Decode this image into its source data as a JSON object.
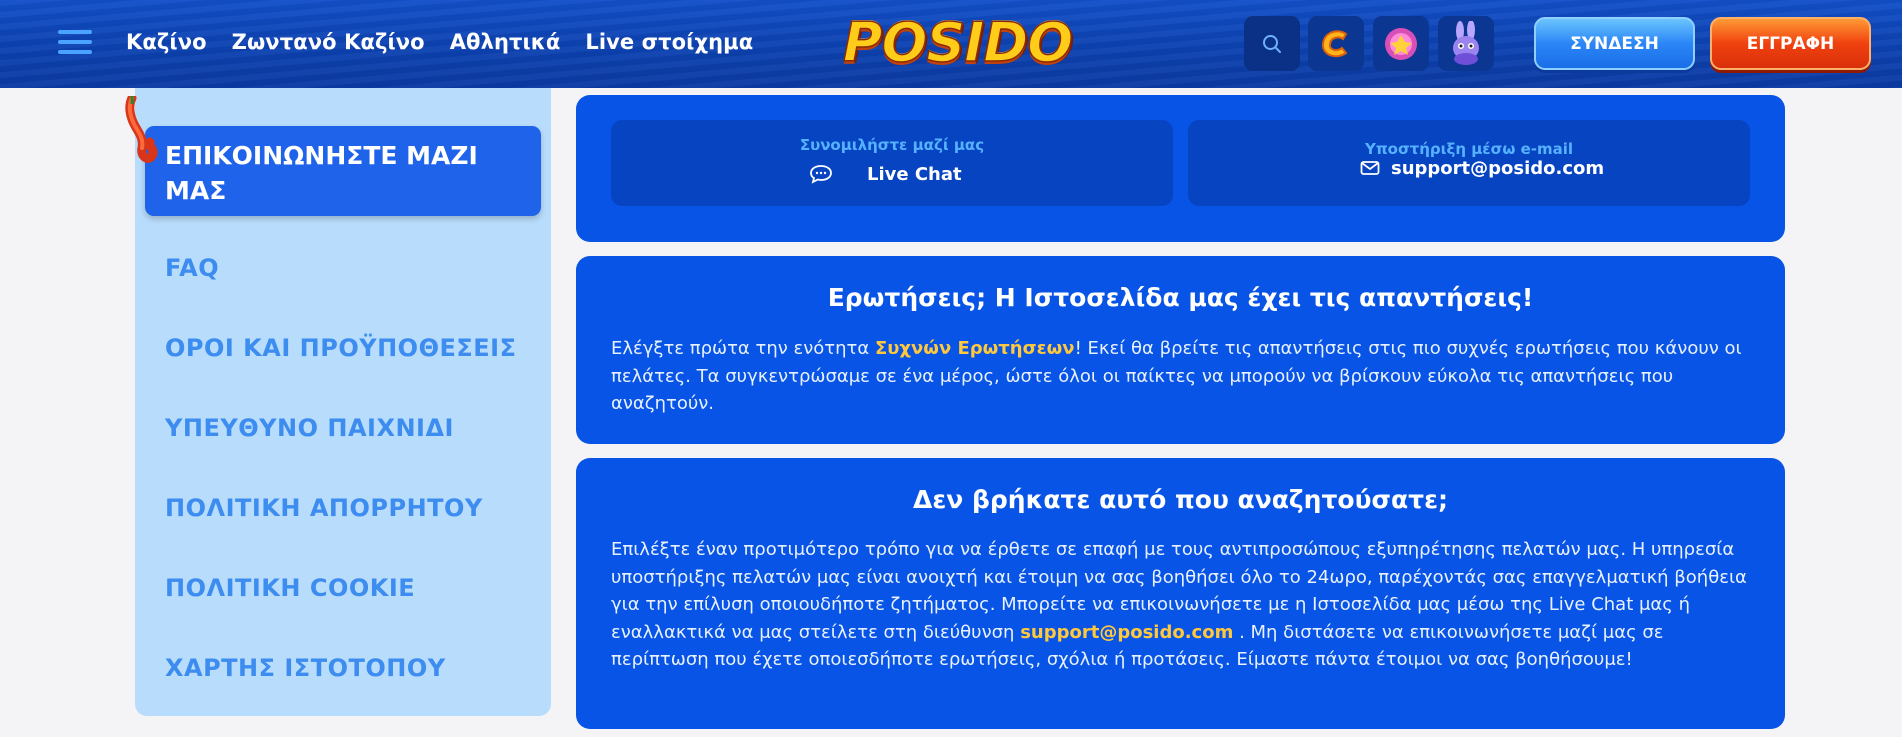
{
  "header": {
    "nav": [
      "Καζίνο",
      "Ζωντανό Καζίνο",
      "Αθλητικά",
      "Live στοίχημα"
    ],
    "logo": "POSIDO",
    "login_label": "ΣΥΝΔΕΣΗ",
    "register_label": "ΕΓΓΡΑΦΗ",
    "icons": [
      "search-icon",
      "c-coin-icon",
      "gem-bonus-icon",
      "rabbit-mascot-icon"
    ]
  },
  "sidebar": {
    "active": "ΕΠΙΚΟΙΝΩΝΗΣΤΕ ΜΑΖΙ ΜΑΣ",
    "active_line1": "ΕΠΙΚΟΙΝΩΝΗΣΤΕ ΜΑΖΙ",
    "active_line2": "ΜΑΣ",
    "items": [
      "FAQ",
      "ΟΡΟΙ ΚΑΙ ΠΡΟΫΠΟΘΕΣΕΙΣ",
      "ΥΠΕΥΘΥΝΟ ΠΑΙΧΝΙΔΙ",
      "ΠΟΛΙΤΙΚΗ ΑΠΟΡΡΗΤΟΥ",
      "ΠΟΛΙΤΙΚΗ COOKIE",
      "ΧΑΡΤΗΣ ΙΣΤΟΤΟΠΟΥ"
    ]
  },
  "contact": {
    "chat_label": "Συνομιλήστε μαζί μας",
    "chat_value": "Live Chat",
    "email_label": "Υποστήριξη μέσω e-mail",
    "email_value": "support@posido.com"
  },
  "faq_card": {
    "title": "Ερωτήσεις; Η Ιστοσελίδα μας έχει τις απαντήσεις!",
    "text_before": "Ελέγξτε πρώτα την ενότητα ",
    "link": "Συχνών Ερωτήσεων",
    "text_after": "! Εκεί θα βρείτε τις απαντήσεις στις πιο συχνές ερωτήσεις που κάνουν οι πελάτες. Τα συγκεντρώσαμε σε ένα μέρος, ώστε όλοι οι παίκτες να μπορούν να βρίσκουν εύκολα τις απαντήσεις που αναζητούν."
  },
  "help_card": {
    "title": "Δεν βρήκατε αυτό που αναζητούσατε;",
    "text_before": "Επιλέξτε έναν προτιμότερο τρόπο για να έρθετε σε επαφή με τους αντιπροσώπους εξυπηρέτησης πελατών μας. Η υπηρεσία υποστήριξης πελατών μας είναι ανοιχτή και έτοιμη να σας βοηθήσει όλο το 24ωρο, παρέχοντάς σας επαγγελματική βοήθεια για την επίλυση οποιουδήποτε ζητήματος. Μπορείτε να επικοινωνήσετε με η Ιστοσελίδα μας μέσω της Live Chat μας ή εναλλακτικά να μας στείλετε στη διεύθυνση ",
    "link": "support@posido.com",
    "text_after": " . Μη διστάσετε να επικοινωνήσετε μαζί μας σε περίπτωση που έχετε οποιεσδήποτε ερωτήσεις, σχόλια ή προτάσεις. Είμαστε πάντα έτοιμοι να σας βοηθήσουμε!"
  }
}
